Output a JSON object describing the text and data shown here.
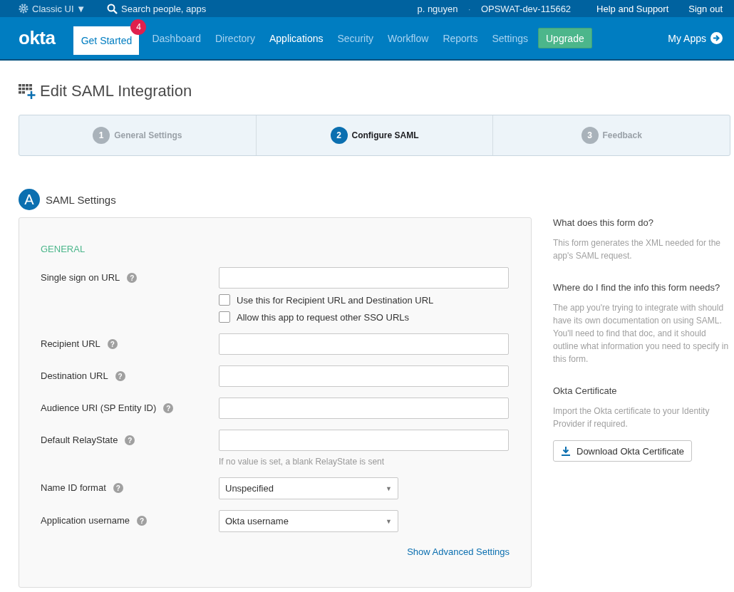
{
  "topbar": {
    "switcher": "Classic UI",
    "switcher_caret": "▼",
    "search_placeholder": "Search people, apps",
    "user": "p. nguyen",
    "separator": "·",
    "org": "OPSWAT-dev-115662",
    "links": [
      "Help and Support",
      "Sign out"
    ]
  },
  "nav": {
    "logo": "okta",
    "get_started": {
      "label": "Get Started",
      "badge": "4"
    },
    "items": [
      {
        "label": "Dashboard",
        "selected": false
      },
      {
        "label": "Directory",
        "selected": false
      },
      {
        "label": "Applications",
        "selected": true
      },
      {
        "label": "Security",
        "selected": false
      },
      {
        "label": "Workflow",
        "selected": false
      },
      {
        "label": "Reports",
        "selected": false
      },
      {
        "label": "Settings",
        "selected": false
      }
    ],
    "upgrade": "Upgrade",
    "my_apps": "My Apps"
  },
  "page_title": "Edit SAML Integration",
  "steps": [
    {
      "number": "1",
      "label": "General Settings",
      "selected": false
    },
    {
      "number": "2",
      "label": "Configure SAML",
      "selected": true
    },
    {
      "number": "3",
      "label": "Feedback",
      "selected": false
    }
  ],
  "section": {
    "letter": "A",
    "title": "SAML Settings"
  },
  "form": {
    "group": "GENERAL",
    "rows": [
      {
        "kind": "text",
        "label": "Single sign on URL",
        "help": "?",
        "checkboxes": [
          {
            "label": "Use this for Recipient URL and Destination URL",
            "checked": false
          },
          {
            "label": "Allow this app to request other SSO URLs",
            "checked": false
          }
        ]
      },
      {
        "kind": "text",
        "label": "Recipient URL",
        "help": "?"
      },
      {
        "kind": "text",
        "label": "Destination URL",
        "help": "?"
      },
      {
        "kind": "text",
        "label": "Audience URI (SP Entity ID)",
        "help": "?"
      },
      {
        "kind": "text",
        "label": "Default RelayState",
        "help": "?",
        "hint": "If no value is set, a blank RelayState is sent"
      },
      {
        "kind": "select",
        "label": "Name ID format",
        "help": "?",
        "value": "Unspecified",
        "caret": "▼"
      },
      {
        "kind": "select",
        "label": "Application username",
        "help": "?",
        "value": "Okta username",
        "caret": "▼"
      }
    ],
    "advanced_link": "Show Advanced Settings"
  },
  "sidebar": {
    "sections": [
      {
        "title": "What does this form do?",
        "body": "This form generates the XML needed for the app's SAML request."
      },
      {
        "title": "Where do I find the info this form needs?",
        "body": "The app you're trying to integrate with should have its own documentation on using SAML. You'll need to find that doc, and it should outline what information you need to specify in this form."
      },
      {
        "title": "Okta Certificate",
        "body": "Import the Okta certificate to your Identity Provider if required."
      }
    ],
    "button": "Download Okta Certificate"
  }
}
